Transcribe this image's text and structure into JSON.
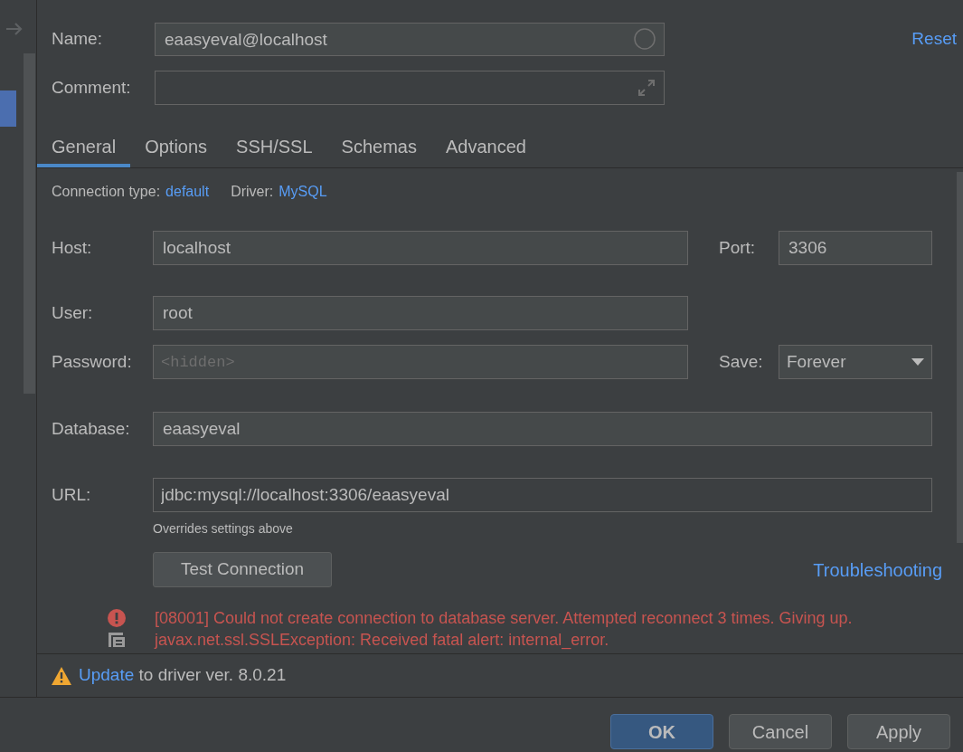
{
  "name_field": {
    "label": "Name:",
    "value": "eaasyeval@localhost"
  },
  "comment_field": {
    "label": "Comment:"
  },
  "reset_link": "Reset",
  "tabs": [
    {
      "label": "General",
      "selected": true
    },
    {
      "label": "Options",
      "selected": false
    },
    {
      "label": "SSH/SSL",
      "selected": false
    },
    {
      "label": "Schemas",
      "selected": false
    },
    {
      "label": "Advanced",
      "selected": false
    }
  ],
  "connection_info": [
    {
      "label": "Connection type:",
      "value": "default"
    },
    {
      "label": "Driver:",
      "value": "MySQL"
    }
  ],
  "host": {
    "label": "Host:",
    "value": "localhost"
  },
  "port": {
    "label": "Port:",
    "value": "3306"
  },
  "user": {
    "label": "User:",
    "value": "root"
  },
  "password": {
    "label": "Password:",
    "placeholder": "<hidden>"
  },
  "save": {
    "label": "Save:",
    "value": "Forever"
  },
  "database": {
    "label": "Database:",
    "value": "eaasyeval"
  },
  "url": {
    "label": "URL:",
    "value": "jdbc:mysql://localhost:3306/eaasyeval",
    "note": "Overrides settings above"
  },
  "test_button": "Test Connection",
  "troubleshooting_link": "Troubleshooting",
  "errors": [
    "[08001] Could not create connection to database server. Attempted reconnect 3 times. Giving up.",
    "javax.net.ssl.SSLException: Received fatal alert: internal_error."
  ],
  "driver_notice": {
    "link": "Update",
    "text": "to driver ver. 8.0.21"
  },
  "buttons": [
    {
      "label": "OK",
      "kind": "default"
    },
    {
      "label": "Cancel",
      "kind": "normal"
    },
    {
      "label": "Apply",
      "kind": "normal"
    }
  ]
}
